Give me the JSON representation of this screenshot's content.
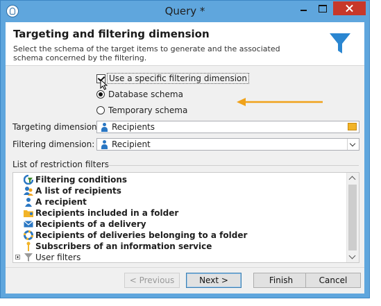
{
  "window": {
    "title": "Query *"
  },
  "header": {
    "title": "Targeting and filtering dimension",
    "description": "Select the schema of the target items to  generate and the associated schema concerned by the filtering."
  },
  "options": {
    "use_specific_filtering": {
      "label": "Use a specific filtering dimension",
      "checked": true
    },
    "schema_choice": [
      {
        "label": "Database schema",
        "selected": true
      },
      {
        "label": "Temporary schema",
        "selected": false
      }
    ]
  },
  "fields": {
    "targeting": {
      "label": "Targeting dimension:",
      "value": "Recipients"
    },
    "filtering": {
      "label": "Filtering dimension:",
      "value": "Recipient"
    }
  },
  "restriction_filters": {
    "label": "List of restriction filters",
    "items": [
      {
        "label": "Filtering conditions",
        "icon": "filtering-conditions-icon"
      },
      {
        "label": "A list of recipients",
        "icon": "recipient-list-icon"
      },
      {
        "label": "A recipient",
        "icon": "recipient-icon"
      },
      {
        "label": "Recipients included in a folder",
        "icon": "folder-icon"
      },
      {
        "label": "Recipients of a delivery",
        "icon": "envelope-icon"
      },
      {
        "label": "Recipients of deliveries belonging to a folder",
        "icon": "lifebuoy-icon"
      },
      {
        "label": "Subscribers of an information service",
        "icon": "subscription-icon"
      },
      {
        "label": "User filters",
        "icon": "funnel-icon"
      }
    ]
  },
  "buttons": {
    "previous": "< Previous",
    "next": "Next >",
    "finish": "Finish",
    "cancel": "Cancel"
  },
  "colors": {
    "accent": "#2a86d1",
    "annotation_arrow": "#f0a21a",
    "title_bar": "#5fa6dd"
  }
}
